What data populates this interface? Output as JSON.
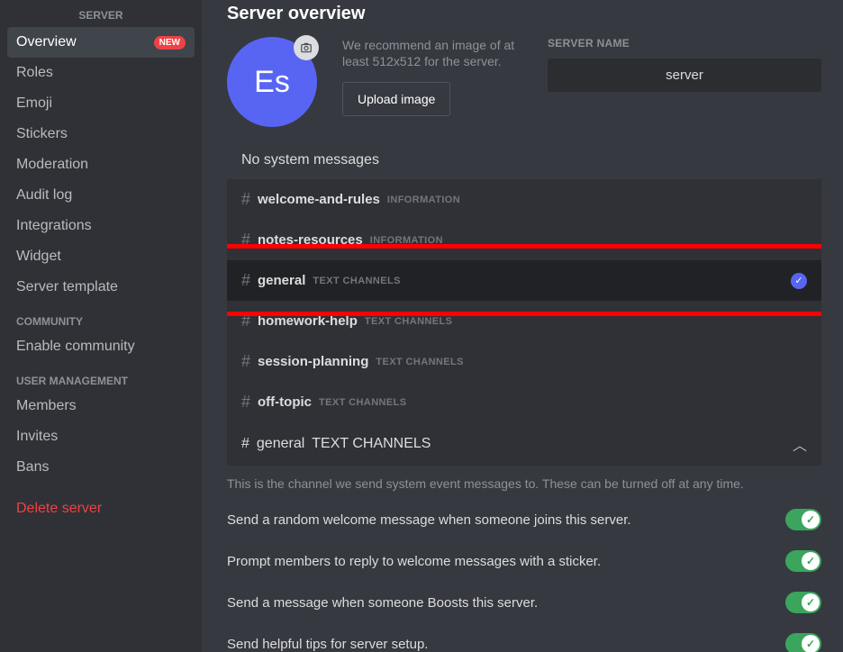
{
  "sidebar": {
    "header": "SERVER",
    "items": [
      {
        "label": "Overview",
        "active": true,
        "badge": "NEW"
      },
      {
        "label": "Roles"
      },
      {
        "label": "Emoji"
      },
      {
        "label": "Stickers"
      },
      {
        "label": "Moderation"
      },
      {
        "label": "Audit log"
      },
      {
        "label": "Integrations"
      },
      {
        "label": "Widget"
      },
      {
        "label": "Server template"
      }
    ],
    "community_header": "COMMUNITY",
    "community_items": [
      {
        "label": "Enable community"
      }
    ],
    "um_header": "USER MANAGEMENT",
    "um_items": [
      {
        "label": "Members"
      },
      {
        "label": "Invites"
      },
      {
        "label": "Bans"
      }
    ],
    "delete": "Delete server"
  },
  "main": {
    "title": "Server overview",
    "avatar_initials": "Es",
    "reco": "We recommend an image of at least 512x512 for the server.",
    "upload_btn": "Upload image",
    "name_label": "SERVER NAME",
    "name_value": "server",
    "dropdown": {
      "head": "No system messages",
      "items": [
        {
          "name": "welcome-and-rules",
          "cat": "INFORMATION"
        },
        {
          "name": "notes-resources",
          "cat": "INFORMATION"
        },
        {
          "name": "general",
          "cat": "TEXT CHANNELS",
          "selected": true,
          "highlight": true
        },
        {
          "name": "homework-help",
          "cat": "TEXT CHANNELS"
        },
        {
          "name": "session-planning",
          "cat": "TEXT CHANNELS"
        },
        {
          "name": "off-topic",
          "cat": "TEXT CHANNELS"
        }
      ],
      "selected_display": {
        "name": "general",
        "cat": "TEXT CHANNELS"
      }
    },
    "helper": "This is the channel we send system event messages to. These can be turned off at any time.",
    "toggles": [
      {
        "label": "Send a random welcome message when someone joins this server.",
        "on": true
      },
      {
        "label": "Prompt members to reply to welcome messages with a sticker.",
        "on": true
      },
      {
        "label": "Send a message when someone Boosts this server.",
        "on": true
      },
      {
        "label": "Send helpful tips for server setup.",
        "on": true
      }
    ]
  }
}
